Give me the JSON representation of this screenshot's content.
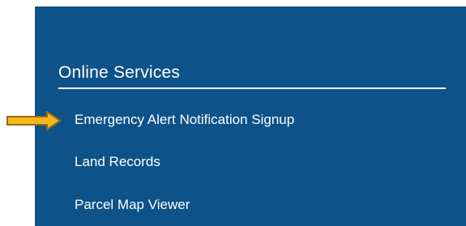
{
  "online_services": {
    "title": "Online Services",
    "items": [
      {
        "label": "Emergency Alert Notification Signup"
      },
      {
        "label": "Land Records"
      },
      {
        "label": "Parcel Map Viewer"
      }
    ]
  },
  "colors": {
    "panel_background": "#0d5289",
    "text": "#ffffff",
    "arrow_fill": "#f5b719",
    "arrow_outline": "#9a6a14"
  },
  "icons": {
    "pointer": "arrow-right-icon"
  }
}
